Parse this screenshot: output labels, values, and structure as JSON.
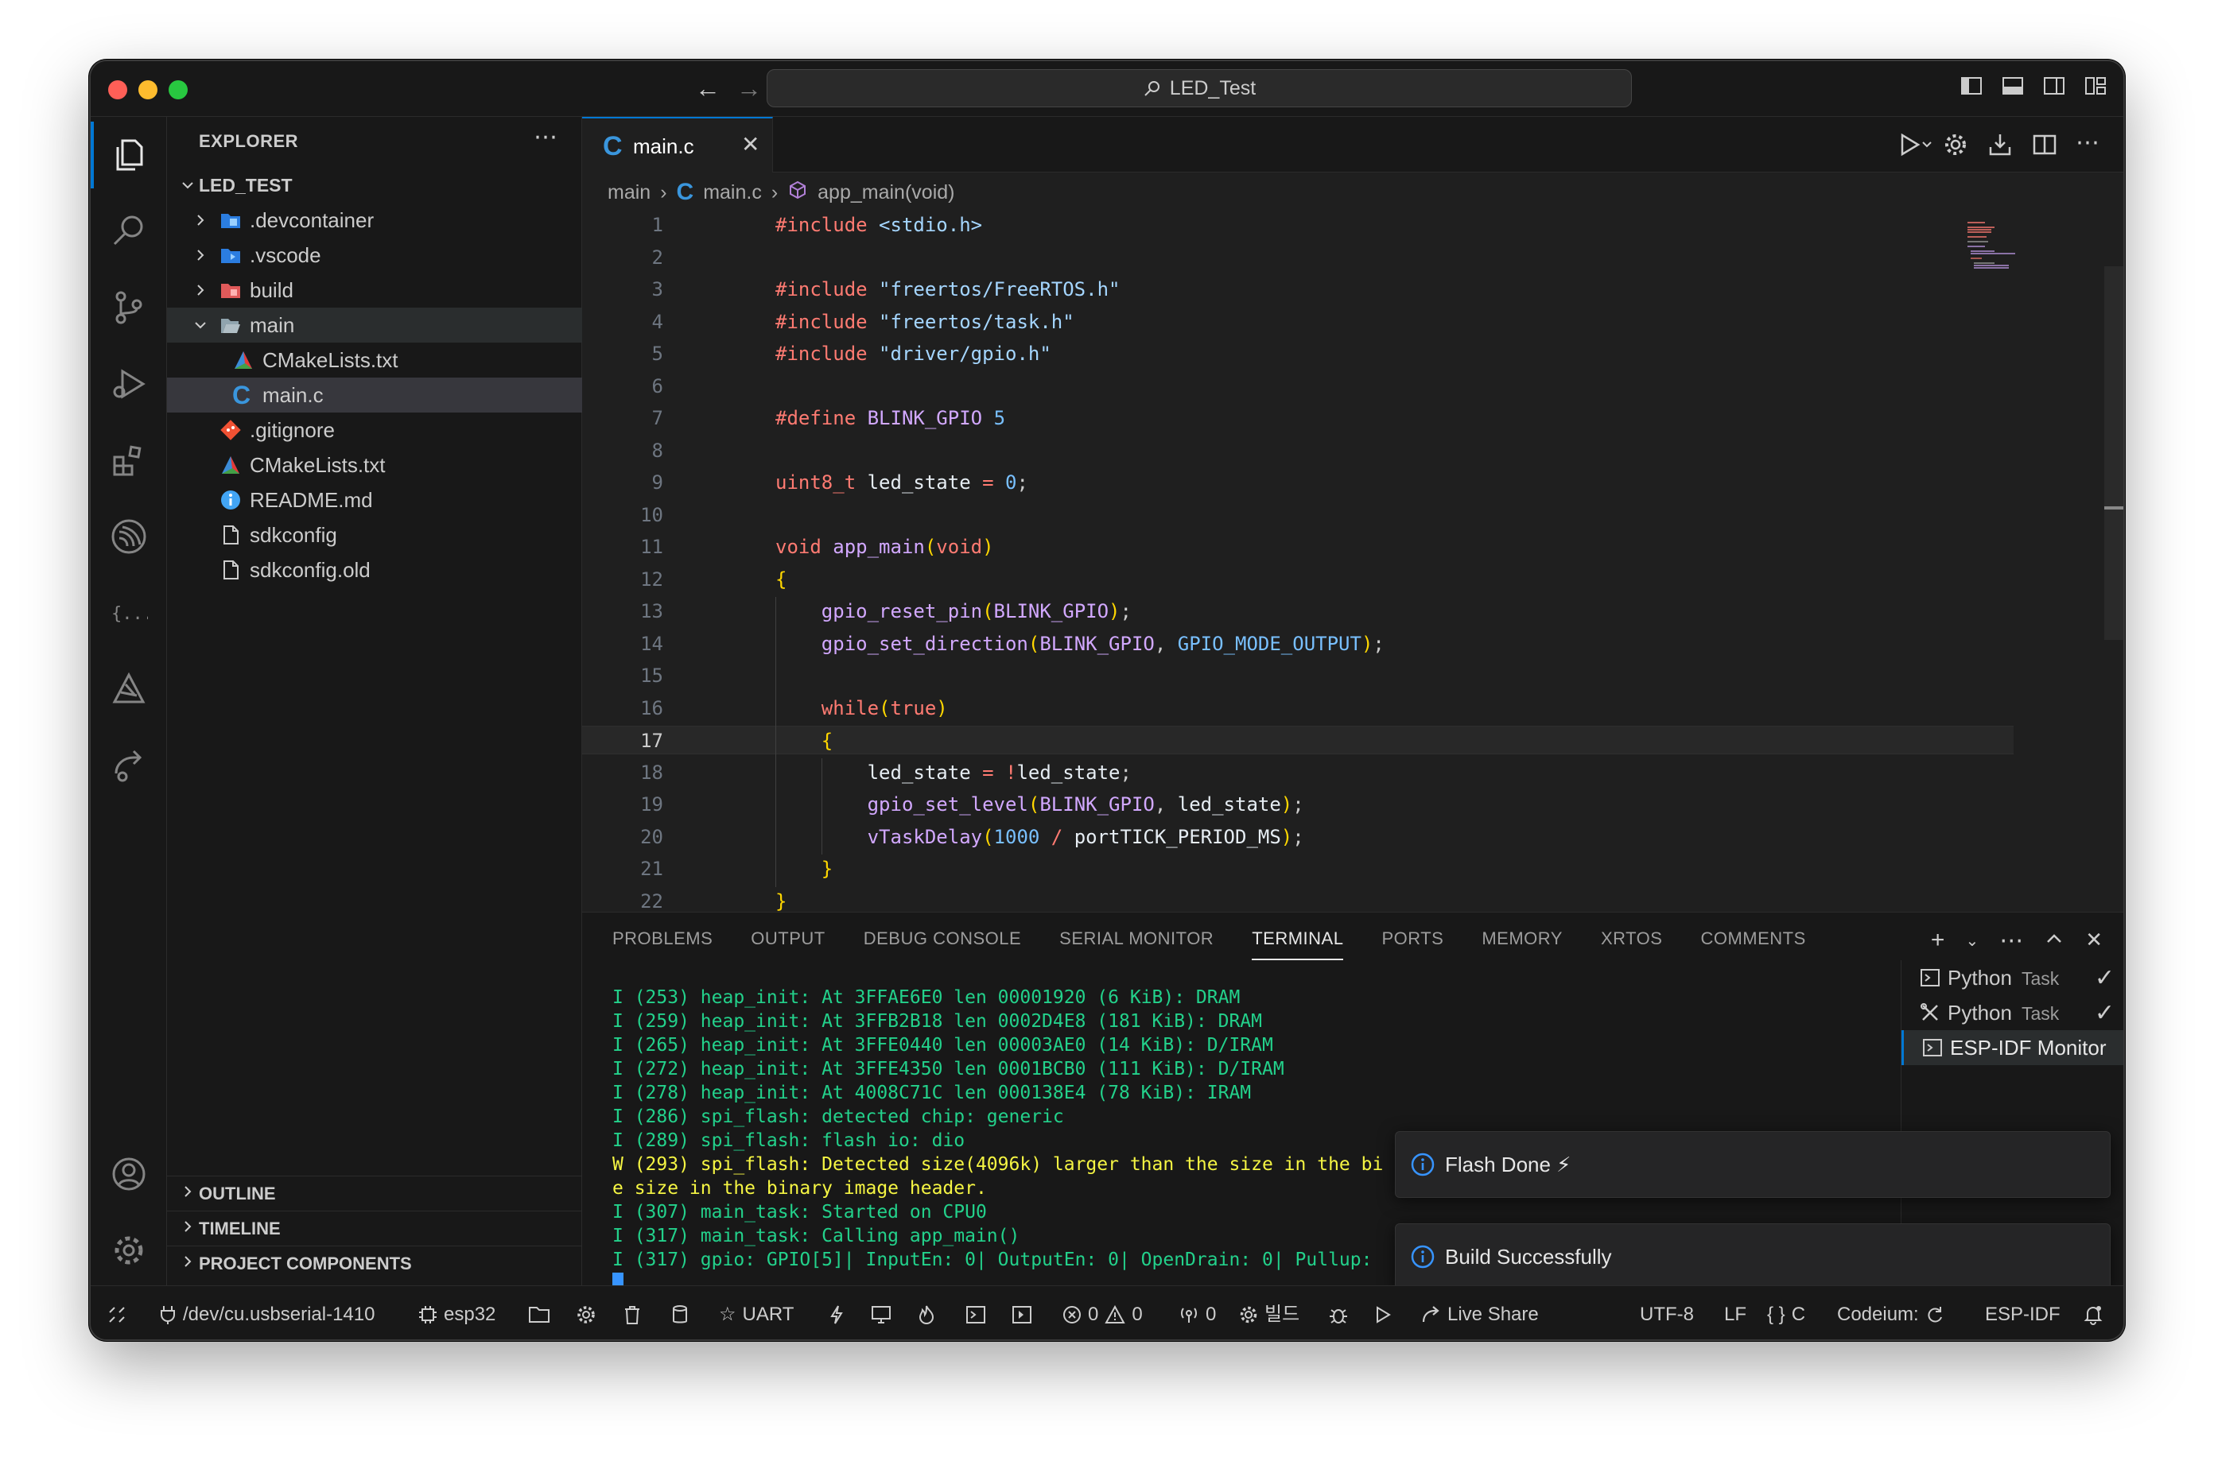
{
  "window": {
    "search_label": "LED_Test"
  },
  "sidebar": {
    "header": "EXPLORER",
    "root": "LED_TEST",
    "items": [
      {
        "label": ".devcontainer",
        "kind": "folder",
        "icon": "devcontainer-folder-icon"
      },
      {
        "label": ".vscode",
        "kind": "folder",
        "icon": "vscode-folder-icon"
      },
      {
        "label": "build",
        "kind": "folder",
        "icon": "build-folder-icon"
      },
      {
        "label": "main",
        "kind": "folder-open",
        "icon": "folder-open-icon"
      },
      {
        "label": "CMakeLists.txt",
        "kind": "file",
        "icon": "cmake-icon"
      },
      {
        "label": "main.c",
        "kind": "file",
        "icon": "c-file-icon"
      },
      {
        "label": ".gitignore",
        "kind": "file",
        "icon": "git-icon"
      },
      {
        "label": "CMakeLists.txt",
        "kind": "file",
        "icon": "cmake-icon"
      },
      {
        "label": "README.md",
        "kind": "file",
        "icon": "info-icon"
      },
      {
        "label": "sdkconfig",
        "kind": "file",
        "icon": "file-icon"
      },
      {
        "label": "sdkconfig.old",
        "kind": "file",
        "icon": "file-icon"
      }
    ],
    "sections": [
      "OUTLINE",
      "TIMELINE",
      "PROJECT COMPONENTS"
    ]
  },
  "editor": {
    "tab_label": "main.c",
    "breadcrumb": [
      "main",
      "main.c",
      "app_main(void)"
    ],
    "current_line": 17,
    "lines": [
      "#include <stdio.h>",
      "",
      "#include \"freertos/FreeRTOS.h\"",
      "#include \"freertos/task.h\"",
      "#include \"driver/gpio.h\"",
      "",
      "#define BLINK_GPIO 5",
      "",
      "uint8_t led_state = 0;",
      "",
      "void app_main(void)",
      "{",
      "    gpio_reset_pin(BLINK_GPIO);",
      "    gpio_set_direction(BLINK_GPIO, GPIO_MODE_OUTPUT);",
      "",
      "    while(true)",
      "    {",
      "        led_state = !led_state;",
      "        gpio_set_level(BLINK_GPIO, led_state);",
      "        vTaskDelay(1000 / portTICK_PERIOD_MS);",
      "    }",
      "}",
      ""
    ]
  },
  "panel": {
    "tabs": [
      "PROBLEMS",
      "OUTPUT",
      "DEBUG CONSOLE",
      "SERIAL MONITOR",
      "TERMINAL",
      "PORTS",
      "MEMORY",
      "XRTOS",
      "COMMENTS"
    ],
    "active_tab": "TERMINAL",
    "terminal_lines": [
      {
        "text": "I (253) heap_init: At 3FFAE6E0 len 00001920 (6 KiB): DRAM",
        "level": "info"
      },
      {
        "text": "I (259) heap_init: At 3FFB2B18 len 0002D4E8 (181 KiB): DRAM",
        "level": "info"
      },
      {
        "text": "I (265) heap_init: At 3FFE0440 len 00003AE0 (14 KiB): D/IRAM",
        "level": "info"
      },
      {
        "text": "I (272) heap_init: At 3FFE4350 len 0001BCB0 (111 KiB): D/IRAM",
        "level": "info"
      },
      {
        "text": "I (278) heap_init: At 4008C71C len 000138E4 (78 KiB): IRAM",
        "level": "info"
      },
      {
        "text": "I (286) spi_flash: detected chip: generic",
        "level": "info"
      },
      {
        "text": "I (289) spi_flash: flash io: dio",
        "level": "info"
      },
      {
        "text": "W (293) spi_flash: Detected size(4096k) larger than the size in the bi",
        "level": "warn"
      },
      {
        "text": "e size in the binary image header.",
        "level": "warn"
      },
      {
        "text": "I (307) main_task: Started on CPU0",
        "level": "info"
      },
      {
        "text": "I (317) main_task: Calling app_main()",
        "level": "info"
      },
      {
        "text": "I (317) gpio: GPIO[5]| InputEn: 0| OutputEn: 0| OpenDrain: 0| Pullup:",
        "level": "info"
      }
    ],
    "terminals": [
      {
        "name": "Python",
        "task": "Task",
        "check": "✓"
      },
      {
        "name": "Python",
        "task": "Task",
        "check": "✓"
      },
      {
        "name": "ESP-IDF Monitor",
        "task": "",
        "check": ""
      }
    ]
  },
  "notifications": [
    {
      "text": "Flash Done ⚡"
    },
    {
      "text": "Build Successfully"
    }
  ],
  "statusbar": {
    "port": "/dev/cu.usbserial-1410",
    "target": "esp32",
    "uart": "UART",
    "errors": "0",
    "warnings": "0",
    "ports_count": "0",
    "build_label": "빌드",
    "live_share": "Live Share",
    "encoding": "UTF-8",
    "eol": "LF",
    "language": "C",
    "codeium": "Codeium:",
    "esp_idf": "ESP-IDF"
  },
  "colors": {
    "accent": "#0078d4",
    "terminal_info": "#23d18b",
    "terminal_warn": "#f5f543"
  }
}
